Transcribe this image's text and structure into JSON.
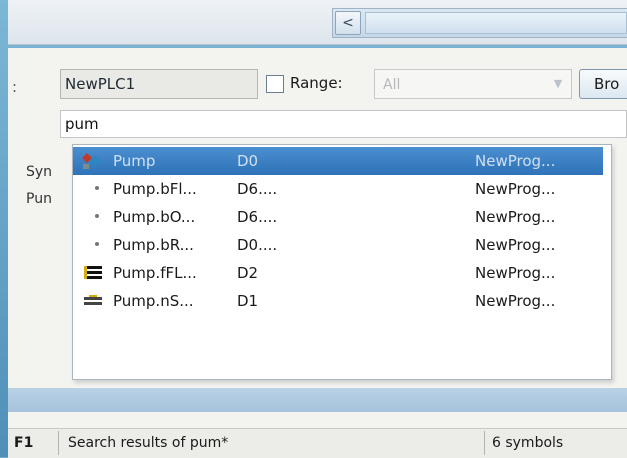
{
  "toolbar": {
    "scroll_left_glyph": "<"
  },
  "filter": {
    "plc_name": "NewPLC1",
    "range_label": "Range:",
    "range_value": "All",
    "browse_label": "Bro"
  },
  "search": {
    "value": "pum"
  },
  "background_list": {
    "header": "Syn",
    "row1": "Pun"
  },
  "autocomplete": {
    "items": [
      {
        "name": "Pump",
        "address": "D0",
        "program": "NewProg...",
        "icon": "function-block-icon",
        "selected": true
      },
      {
        "name": "Pump.bFl...",
        "address": "D6....",
        "program": "NewProg...",
        "icon": "bool-variable-icon"
      },
      {
        "name": "Pump.bO...",
        "address": "D6....",
        "program": "NewProg...",
        "icon": "bool-variable-icon"
      },
      {
        "name": "Pump.bR...",
        "address": "D0....",
        "program": "NewProg...",
        "icon": "bool-variable-icon"
      },
      {
        "name": "Pump.fFL...",
        "address": "D2",
        "program": "NewProg...",
        "icon": "float-variable-icon"
      },
      {
        "name": "Pump.nS...",
        "address": "D1",
        "program": "NewProg...",
        "icon": "int-variable-icon"
      }
    ]
  },
  "statusbar": {
    "key": "F1",
    "message": "Search results of pum*",
    "count": "6 symbols"
  },
  "colors": {
    "selection": "#3b82c8",
    "accent": "#4f8fb8"
  }
}
